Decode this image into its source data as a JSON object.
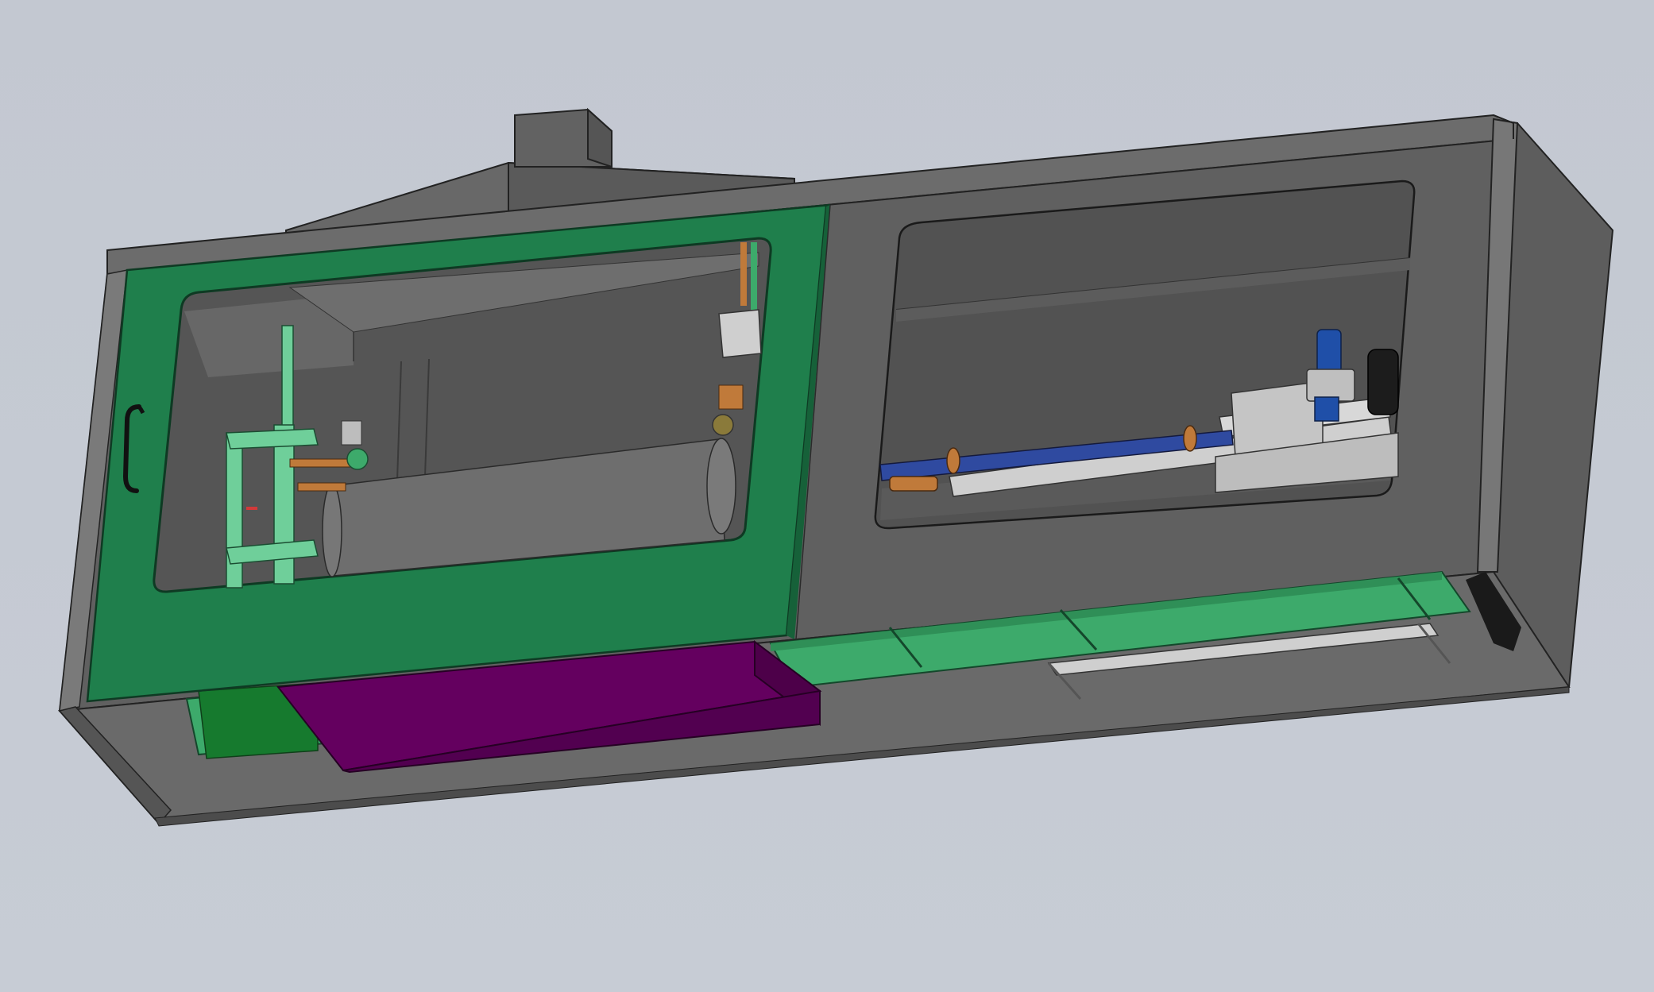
{
  "scene": {
    "background_color": "#c5cad3",
    "colors": {
      "housing": "#5f5f5f",
      "housing_light": "#6e6e6e",
      "housing_dark": "#4a4a4a",
      "door_green": "#1f7f4c",
      "frame_green": "#3daa6b",
      "tray_purple": "#64005f",
      "pipe_blue": "#2f4aa0",
      "fitting_orange": "#c07a3a",
      "motor_blue": "#1f4fa8",
      "bracket_silver": "#c9c9c9",
      "jig_green": "#6fcf9a"
    },
    "icons": [
      "door-handle-icon",
      "motor-icon",
      "pipe-clamp-icon"
    ]
  }
}
